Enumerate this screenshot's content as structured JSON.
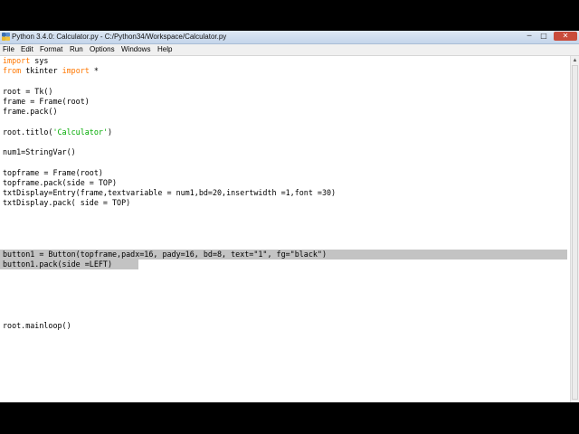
{
  "window": {
    "title": "Python 3.4.0: Calculator.py - C:/Python34/Workspace/Calculator.py",
    "minimize_glyph": "─",
    "maximize_glyph": "□",
    "close_glyph": "✕"
  },
  "menu": [
    "File",
    "Edit",
    "Format",
    "Run",
    "Options",
    "Windows",
    "Help"
  ],
  "code": {
    "l1_kw": "import",
    "l1_rest": " sys",
    "l2_kw1": "from",
    "l2_mid": " tkinter ",
    "l2_kw2": "import",
    "l2_rest": " *",
    "l3": "root = Tk()",
    "l4": "frame = Frame(root)",
    "l5": "frame.pack()",
    "l6_a": "root.titlo(",
    "l6_str": "'Calculator'",
    "l6_b": ")",
    "l7": "num1=StringVar()",
    "l8": "topframe = Frame(root)",
    "l9": "topframe.pack(side = TOP)",
    "l10": "txtDisplay=Entry(frame,textvariable = num1,bd=20,insertwidth =1,font =30)",
    "l11": "txtDisplay.pack( side = TOP)",
    "l12": "button1 = Button(topframe,padx=16, pady=16, bd=8, text=\"1\", fg=\"black\")",
    "l13": "button1.pack(side =LEFT)",
    "l14": "root.mainloop()"
  },
  "colors": {
    "keyword": "#ff7700",
    "string": "#00aa00",
    "selection": "#c3c3c3"
  }
}
